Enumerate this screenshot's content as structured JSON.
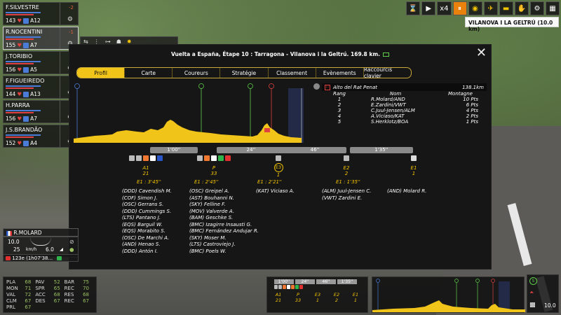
{
  "riders": [
    {
      "name": "F.SILVESTRE",
      "energy": "143",
      "position": "A12",
      "gap": "-2",
      "jersey_color": "#4a7bd6"
    },
    {
      "name": "R.NOCENTINI",
      "energy": "155",
      "position": "A7",
      "gap": "-1",
      "jersey_color": "#4a7bd6"
    },
    {
      "name": "J.TORIBIO",
      "energy": "156",
      "position": "A5",
      "gap": "",
      "jersey_color": "#4a7bd6"
    },
    {
      "name": "F.FIGUEIREDO",
      "energy": "144",
      "position": "A13",
      "gap": "",
      "jersey_color": "#4a7bd6"
    },
    {
      "name": "H.PARRA",
      "energy": "156",
      "position": "A7",
      "gap": "",
      "jersey_color": "#4a7bd6"
    },
    {
      "name": "J.S.BRANDÃO",
      "energy": "152",
      "position": "A4",
      "gap": "",
      "jersey_color": "#4a7bd6"
    }
  ],
  "toolbar": {
    "speed_x": "x4",
    "location": "VILANOVA I LA GELTRÚ (10.0 km)"
  },
  "modal": {
    "title": "Vuelta a España, Étape 10 : Tarragona - Vilanova i la Geltrú. 169.8 km.",
    "tabs": [
      "Profil",
      "Carte",
      "Coureurs",
      "Stratégie",
      "Classement",
      "Evènements",
      "Raccourcis clavier"
    ],
    "active_tab": "Profil",
    "time_gaps": [
      "1'00''",
      "24''",
      "46''",
      "1'35''"
    ],
    "events": [
      {
        "label": "A1",
        "value": "21"
      },
      {
        "label": "P",
        "value": "33"
      },
      {
        "label": "E3",
        "value": "1"
      },
      {
        "label": "E2",
        "value": "2"
      },
      {
        "label": "E1",
        "value": "1"
      }
    ],
    "group_gaps": [
      "E1 : 3'45''",
      "E1 : 2'45''",
      "E1 : 2'21''",
      "E1 : 1'35''"
    ],
    "group1": [
      "(DDD) Cavendish M.",
      "(COF) Simon J.",
      "(OSC) Gerrans S.",
      "(DDD) Cummings S.",
      "(LTS) Pantano J.",
      "(EQS) Barguil W.",
      "(EQS) Morabito S.",
      "(OSC) De Marchi A.",
      "(AND) Henao S.",
      "(DDD) Antón I."
    ],
    "group2": [
      "(OSC) Greipel A.",
      "(AST) Bouhanni N.",
      "(SKY) Felline F.",
      "(MOV) Valverde A.",
      "(BAM) Geschke S.",
      "(BMC) Izagirre Insausti G.",
      "(BMC) Fernández Andujar R.",
      "(SKY) Moser M.",
      "(LTS) Castroviejo J.",
      "(BMC) Poels W."
    ],
    "group3": [
      "(KAT) Viciaso A."
    ],
    "group4": [
      "(ALM) Juul-Jensen C.",
      "(VWT) Zardini E."
    ],
    "group5": [
      "(AND) Molard R."
    ],
    "climb": {
      "name": "Alto del Rat Penat",
      "distance": "138.1km",
      "headers": [
        "Rang",
        "Nom",
        "Montagne"
      ],
      "rows": [
        [
          "1",
          "R.Molard/AND",
          "10 Pts"
        ],
        [
          "2",
          "E.Zardini/VWT",
          "6 Pts"
        ],
        [
          "3",
          "C.Juul-Jensen/ALM",
          "4 Pts"
        ],
        [
          "4",
          "A.Viciaso/KAT",
          "2 Pts"
        ],
        [
          "5",
          "S.Herklotz/BOA",
          "1 Pts"
        ]
      ]
    }
  },
  "selected_rider": {
    "name": "R.MOLARD",
    "speed": "10.0",
    "unit": "km/h",
    "speed2": "25",
    "grade": "6.0",
    "gap": "123e (1h07'38..."
  },
  "stats": [
    [
      "PLA",
      "68"
    ],
    [
      "PAV",
      "52"
    ],
    [
      "BAR",
      "75"
    ],
    [
      "MON",
      "71"
    ],
    [
      "SPR",
      "65"
    ],
    [
      "REC",
      "70"
    ],
    [
      "VAL",
      "72"
    ],
    [
      "ACC",
      "68"
    ],
    [
      "RES",
      "68"
    ],
    [
      "CLM",
      "67"
    ],
    [
      "DES",
      "67"
    ],
    [
      "REC",
      "67"
    ],
    [
      "PRL",
      "67"
    ]
  ],
  "mini_race": {
    "gaps": [
      "1'00''",
      "24''",
      "46''",
      "1'35''"
    ],
    "labels": [
      [
        "A1",
        "21"
      ],
      [
        "P",
        "33"
      ],
      [
        "E3",
        "1"
      ],
      [
        "E2",
        "2"
      ],
      [
        "E1",
        "1"
      ]
    ]
  },
  "right_panel": {
    "distance": "10.0"
  }
}
